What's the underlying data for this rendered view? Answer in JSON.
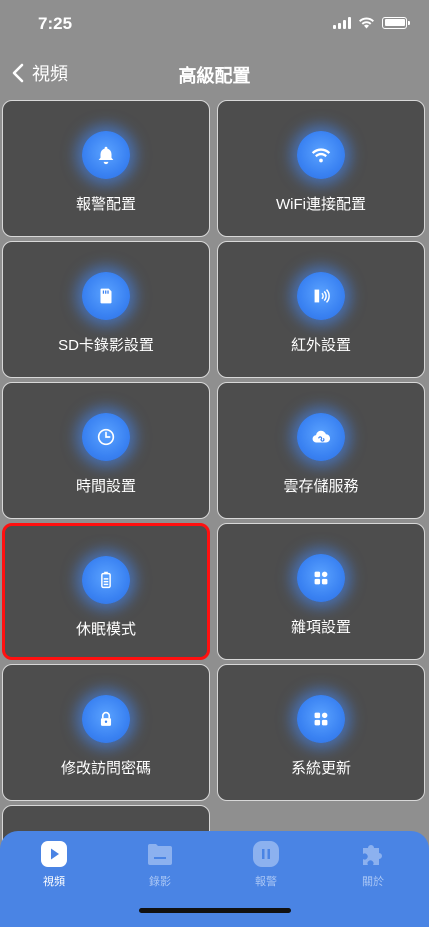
{
  "status_bar": {
    "time": "7:25"
  },
  "nav": {
    "back_label": "視頻",
    "title": "高級配置"
  },
  "tiles": [
    {
      "label": "報警配置",
      "icon": "bell-icon"
    },
    {
      "label": "WiFi連接配置",
      "icon": "wifi-icon"
    },
    {
      "label": "SD卡錄影設置",
      "icon": "sd-card-icon"
    },
    {
      "label": "紅外設置",
      "icon": "infrared-icon"
    },
    {
      "label": "時間設置",
      "icon": "clock-icon"
    },
    {
      "label": "雲存儲服務",
      "icon": "cloud-icon"
    },
    {
      "label": "休眠模式",
      "icon": "battery-icon",
      "selected": true
    },
    {
      "label": "雜項設置",
      "icon": "apps-icon"
    },
    {
      "label": "修改訪問密碼",
      "icon": "lock-icon"
    },
    {
      "label": "系統更新",
      "icon": "apps-icon"
    }
  ],
  "tab_bar": {
    "tabs": [
      {
        "label": "視頻",
        "icon": "play-icon",
        "active": true
      },
      {
        "label": "錄影",
        "icon": "folder-icon",
        "active": false
      },
      {
        "label": "報警",
        "icon": "alarm-icon",
        "active": false
      },
      {
        "label": "關於",
        "icon": "puzzle-icon",
        "active": false
      }
    ]
  },
  "colors": {
    "accent": "#3a82f2",
    "tab_bar": "#4a84e4",
    "tile_bg": "#4d4d4d",
    "selected_border": "#ff1010",
    "page_bg": "#8f8f8f"
  }
}
